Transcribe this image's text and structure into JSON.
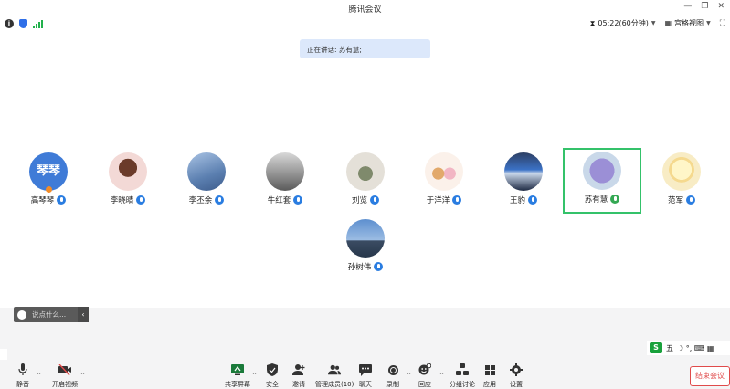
{
  "window": {
    "title": "腾讯会议",
    "minimize_glyph": "—",
    "restore_glyph": "❐",
    "close_glyph": "✕"
  },
  "topbar": {
    "timer": "05:22(60分钟)",
    "layout_label": "宫格视图"
  },
  "speaking": {
    "text": "正在讲话: 苏有慧;"
  },
  "participants": [
    {
      "name": "高琴琴",
      "avatar_text": "琴琴",
      "avatar_color": "#3f7bd7",
      "host": true
    },
    {
      "name": "李晓晴",
      "avatar_color": "#f3d9d6"
    },
    {
      "name": "李丕余",
      "avatar_color": "#6f8fb8"
    },
    {
      "name": "牛红套",
      "avatar_color": "#9a9a9a"
    },
    {
      "name": "刘览",
      "avatar_color": "#c9c5bb"
    },
    {
      "name": "于洋洋",
      "avatar_color": "#f4e3d2"
    },
    {
      "name": "王豹",
      "avatar_color": "#2d3f63"
    },
    {
      "name": "苏有慧",
      "avatar_color": "#8d86c4",
      "active": true
    },
    {
      "name": "范军",
      "avatar_color": "#f8ecc5"
    },
    {
      "name": "孙树伟",
      "avatar_color": "#3b6fa6"
    }
  ],
  "chat": {
    "placeholder": "说点什么..."
  },
  "ime": {
    "logo": "S",
    "mode": "五",
    "glyphs": "☽ °, ⌨ ▦"
  },
  "toolbar": {
    "mute": "静音",
    "video": "开启视频",
    "share": "共享屏幕",
    "security": "安全",
    "invite": "邀请",
    "members": "管理成员(10)",
    "chat": "聊天",
    "record": "录制",
    "react": "回应",
    "breakout": "分组讨论",
    "apps": "应用",
    "settings": "设置",
    "end": "结束会议"
  },
  "colors": {
    "accent": "#2a7de1",
    "active_border": "#34c26a",
    "end_red": "#e04b4b",
    "banner": "#dce8fb"
  }
}
